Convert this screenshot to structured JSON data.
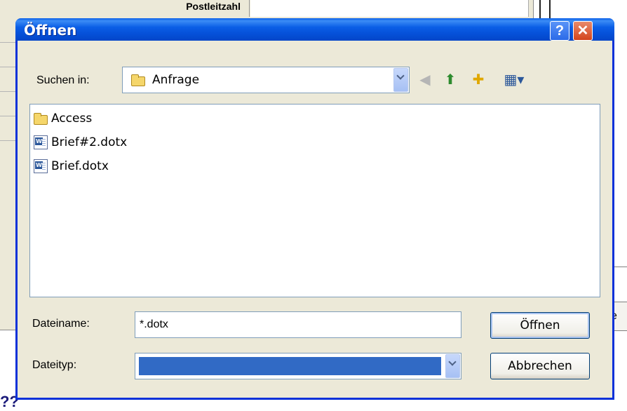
{
  "background": {
    "header_text": "Postleitzahl",
    "side_button_text": "se"
  },
  "dialog": {
    "title": "Öffnen",
    "help_glyph": "?",
    "close_glyph": "✕",
    "look_in_label": "Suchen in:",
    "look_in_value": "Anfrage",
    "files": [
      {
        "name": "Access",
        "icon": "folder-icon"
      },
      {
        "name": "Brief#2.dotx",
        "icon": "word-document-icon"
      },
      {
        "name": "Brief.dotx",
        "icon": "word-document-icon"
      }
    ],
    "filename_label": "Dateiname:",
    "filename_value": "*.dotx",
    "filetype_label": "Dateityp:",
    "open_button": "Öffnen",
    "cancel_button": "Abbrechen",
    "colors": {
      "titlebar": "#0a5fe8",
      "dialog_bg": "#ece9d8",
      "selection": "#316ac5"
    }
  }
}
